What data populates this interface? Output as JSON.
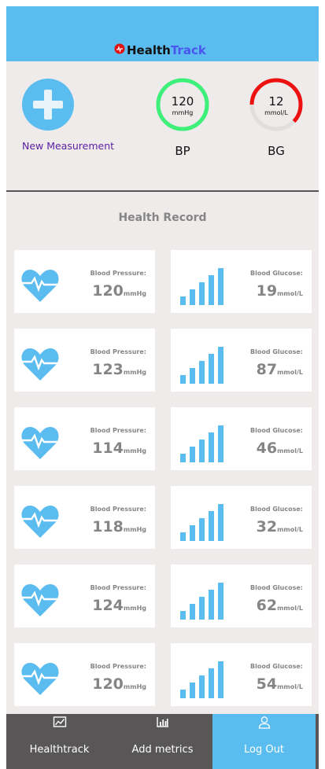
{
  "header": {
    "brand_part1": "Health",
    "brand_part2": "Track"
  },
  "quick": {
    "add_label": "New Measurement",
    "bp": {
      "value": "120",
      "unit": "mmHg",
      "label": "BP",
      "level": 1.0,
      "color": "#3ef07a"
    },
    "bg": {
      "value": "12",
      "unit": "mmol/L",
      "label": "BG",
      "level": 0.62,
      "color": "#ee1111"
    }
  },
  "record": {
    "title": "Health Record",
    "bp_caption": "Blood Pressure:",
    "bg_caption": "Blood Glucose:",
    "rows": [
      {
        "bp": "120",
        "bp_unit": "mmHg",
        "bg": "19",
        "bg_unit": "mmol/L"
      },
      {
        "bp": "123",
        "bp_unit": "mmHg",
        "bg": "87",
        "bg_unit": "mmol/L"
      },
      {
        "bp": "114",
        "bp_unit": "mmHg",
        "bg": "46",
        "bg_unit": "mmol/L"
      },
      {
        "bp": "118",
        "bp_unit": "mmHg",
        "bg": "32",
        "bg_unit": "mmol/L"
      },
      {
        "bp": "124",
        "bp_unit": "mmHg",
        "bg": "62",
        "bg_unit": "mmol/L"
      },
      {
        "bp": "120",
        "bp_unit": "mmHg",
        "bg": "54",
        "bg_unit": "mmol/L"
      }
    ]
  },
  "nav": {
    "items": [
      {
        "label": "Healthtrack",
        "icon": "line-chart-icon",
        "active": false
      },
      {
        "label": "Add metrics",
        "icon": "bar-chart-icon",
        "active": false
      },
      {
        "label": "Log Out",
        "icon": "user-icon",
        "active": true
      }
    ]
  },
  "colors": {
    "accent": "#5bbcef",
    "brand_accent": "#4a55ef",
    "panel": "#efebeb",
    "nav": "#585656",
    "muted_text": "#858585",
    "link": "#5a1fa0"
  }
}
